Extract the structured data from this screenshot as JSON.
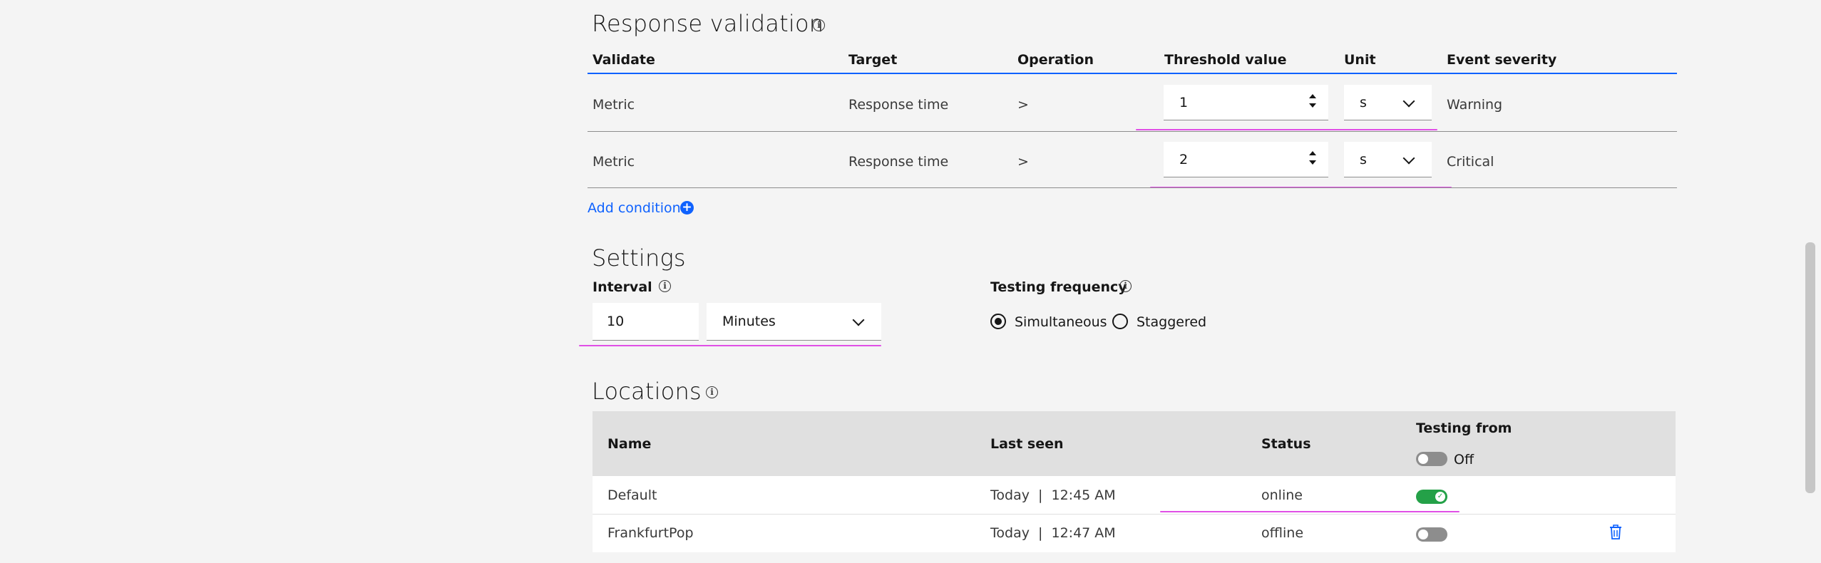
{
  "response_validation": {
    "title": "Response validation",
    "columns": [
      "Validate",
      "Target",
      "Operation",
      "Threshold value",
      "Unit",
      "Event severity"
    ],
    "rows": [
      {
        "validate": "Metric",
        "target": "Response time",
        "operation": ">",
        "threshold": "1",
        "unit": "s",
        "severity": "Warning"
      },
      {
        "validate": "Metric",
        "target": "Response time",
        "operation": ">",
        "threshold": "2",
        "unit": "s",
        "severity": "Critical"
      }
    ],
    "add_condition": "Add condition"
  },
  "settings": {
    "title": "Settings",
    "interval_label": "Interval",
    "interval_value": "10",
    "interval_unit": "Minutes",
    "frequency_label": "Testing frequency",
    "frequency_options": [
      "Simultaneous",
      "Staggered"
    ],
    "frequency_selected": "Simultaneous"
  },
  "locations": {
    "title": "Locations",
    "columns": [
      "Name",
      "Last seen",
      "Status",
      "Testing from"
    ],
    "testing_from_master": "Off",
    "rows": [
      {
        "name": "Default",
        "last_seen": "Today  |  12:45 AM",
        "status": "online",
        "testing": true
      },
      {
        "name": "FrankfurtPop",
        "last_seen": "Today  |  12:47 AM",
        "status": "offline",
        "testing": false
      }
    ]
  },
  "colors": {
    "accent": "#0f62fe",
    "toggle_on": "#24a148",
    "annotation": "#e04fe6"
  },
  "icons": [
    "info-icon",
    "chevron-down-icon",
    "add-circle-icon",
    "trash-icon",
    "checkmark-icon"
  ]
}
